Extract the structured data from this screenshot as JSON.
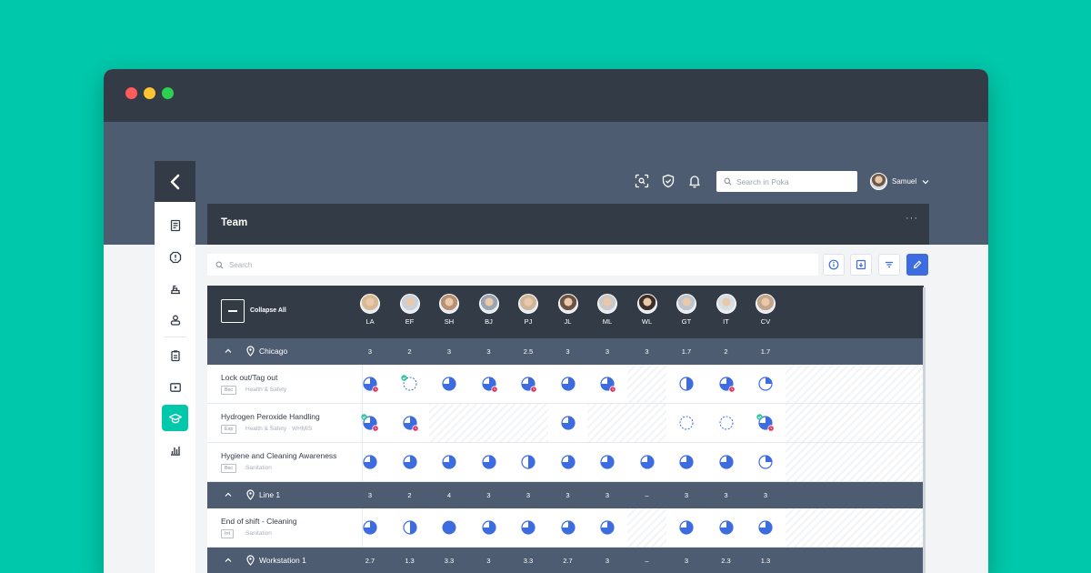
{
  "app": {
    "brand_color": "#00c9ab",
    "accent": "#3d6be0",
    "dark": "#333b47",
    "slate": "#4d5c70",
    "late_badge": "#e0315b",
    "done_check": "#2fc6a0"
  },
  "topbar": {
    "search_placeholder": "Search in Poka",
    "user_name": "Samuel"
  },
  "team": {
    "title": "Team",
    "more": "···"
  },
  "toolbar": {
    "search_placeholder": "Search"
  },
  "grid": {
    "collapse_label": "Collapse All",
    "people": [
      "LA",
      "EF",
      "SH",
      "BJ",
      "PJ",
      "JL",
      "ML",
      "WL",
      "GT",
      "IT",
      "CV"
    ],
    "rows": [
      {
        "kind": "group",
        "name": "Chicago",
        "scores": [
          "3",
          "2",
          "3",
          "3",
          "2.5",
          "3",
          "3",
          "3",
          "1.7",
          "2",
          "1.7"
        ]
      },
      {
        "kind": "skill",
        "name": "Lock out/Tag out",
        "tag": "Bsc",
        "category": "Health & Safety",
        "cells": [
          "3/4L",
          "0D",
          "3/4",
          "3/4L",
          "3/4L",
          "3/4",
          "3/4L",
          "H",
          "1/2",
          "3/4L",
          "1/4"
        ],
        "tail": "H"
      },
      {
        "kind": "skill",
        "name": "Hydrogen Peroxide Handling",
        "tag": "Exp",
        "category": "Health & Safety · WHMIS",
        "cells": [
          "3/4LD",
          "3/4L",
          "H",
          "H",
          "H",
          "3/4",
          "H",
          "H",
          "0",
          "0",
          "3/4LD"
        ],
        "tail": "H"
      },
      {
        "kind": "skill",
        "name": "Hygiene and Cleaning Awareness",
        "tag": "Bsc",
        "category": "Sanitation",
        "cells": [
          "3/4",
          "3/4",
          "3/4",
          "3/4",
          "1/2",
          "3/4",
          "3/4",
          "3/4",
          "3/4",
          "3/4",
          "1/4"
        ],
        "tail": "H"
      },
      {
        "kind": "group",
        "name": "Line 1",
        "scores": [
          "3",
          "2",
          "4",
          "3",
          "3",
          "3",
          "3",
          "–",
          "3",
          "3",
          "3"
        ]
      },
      {
        "kind": "skill",
        "name": "End of shift - Cleaning",
        "tag": "Int",
        "category": "Sanitation",
        "cells": [
          "3/4",
          "1/2",
          "4/4",
          "3/4",
          "3/4",
          "3/4",
          "3/4",
          "H",
          "3/4",
          "3/4",
          "3/4"
        ],
        "tail": "H"
      },
      {
        "kind": "group",
        "name": "Workstation 1",
        "scores": [
          "2.7",
          "1.3",
          "3.3",
          "3",
          "3.3",
          "2.7",
          "3",
          "–",
          "3",
          "2.3",
          "1.3"
        ]
      }
    ]
  }
}
